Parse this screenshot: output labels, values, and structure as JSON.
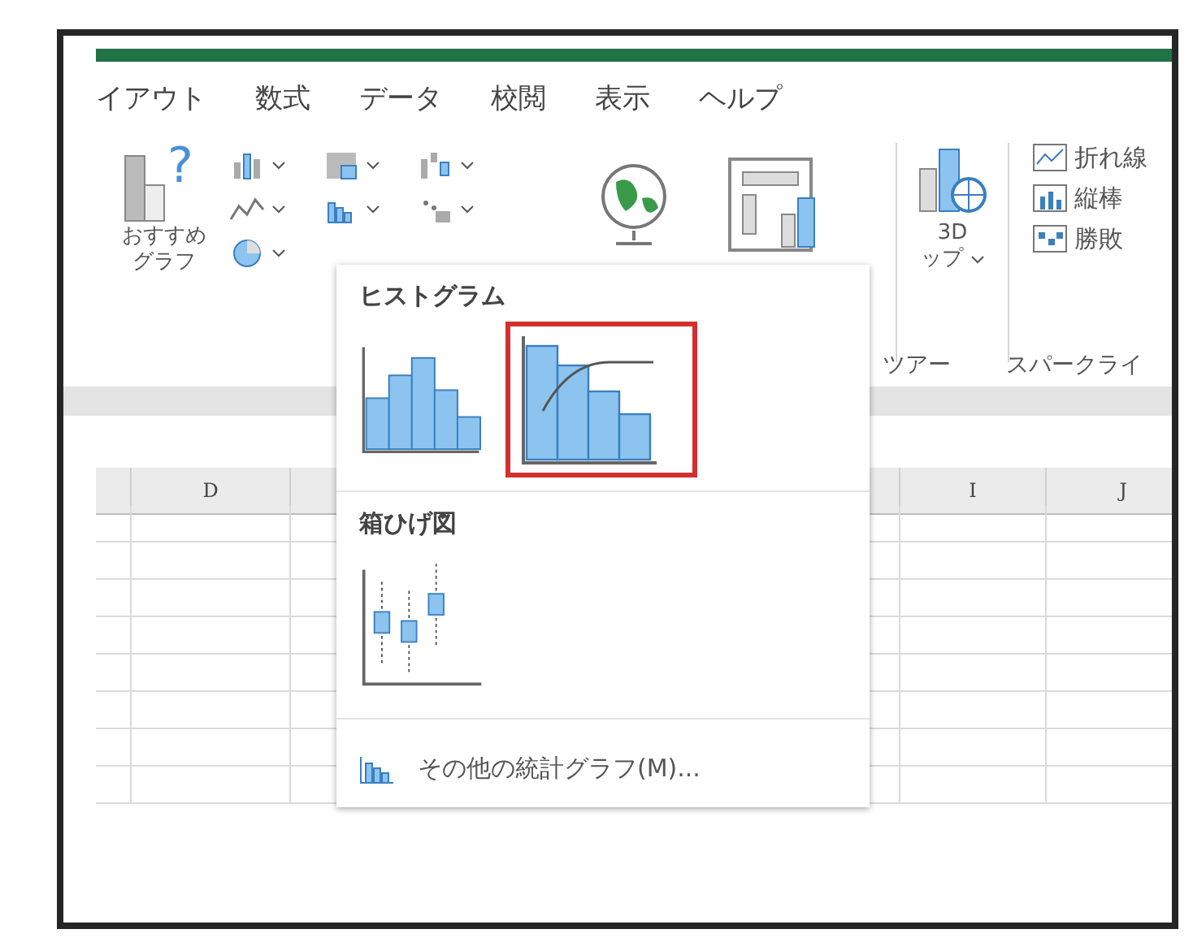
{
  "tabs": [
    {
      "label": "イアウト"
    },
    {
      "label": "数式"
    },
    {
      "label": "データ"
    },
    {
      "label": "校閲"
    },
    {
      "label": "表示"
    },
    {
      "label": "ヘルプ"
    }
  ],
  "ribbon": {
    "recommended": {
      "icon_glyph": "?",
      "lines": [
        "おすすめ",
        "グラフ"
      ]
    },
    "map3d": {
      "lines": [
        "3D",
        "ップ"
      ]
    },
    "sparklines": [
      {
        "label": "折れ線",
        "kind": "line"
      },
      {
        "label": "縦棒",
        "kind": "column"
      },
      {
        "label": "勝敗",
        "kind": "winloss"
      }
    ],
    "group_labels": [
      "ツアー",
      "スパークライ"
    ]
  },
  "sheet": {
    "columns": [
      {
        "label": "D"
      },
      {
        "label": "I"
      },
      {
        "label": "J"
      }
    ]
  },
  "dropdown": {
    "sections": [
      {
        "title": "ヒストグラム",
        "options": [
          {
            "kind": "histogram",
            "selected": false
          },
          {
            "kind": "pareto",
            "selected": true
          }
        ]
      },
      {
        "title": "箱ひげ図",
        "options": [
          {
            "kind": "boxwhisker",
            "selected": false
          }
        ]
      }
    ],
    "footer": "その他の統計グラフ(M)..."
  }
}
